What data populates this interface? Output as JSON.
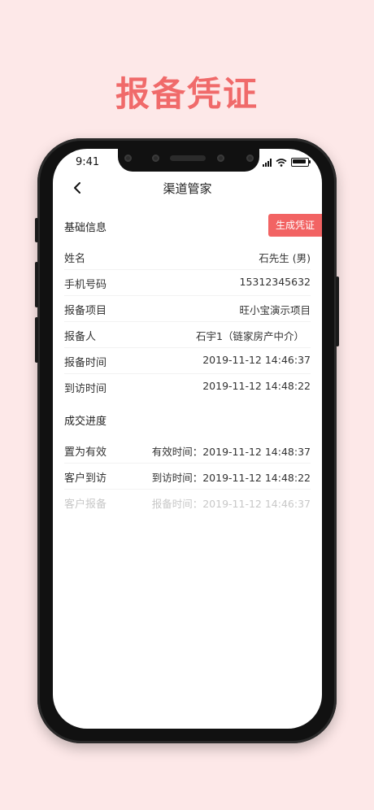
{
  "headline": "报备凭证",
  "status_bar": {
    "time": "9:41"
  },
  "nav": {
    "title": "渠道管家"
  },
  "basic": {
    "title": "基础信息",
    "generate_button": "生成凭证",
    "rows": [
      {
        "label": "姓名",
        "value": "石先生 (男)"
      },
      {
        "label": "手机号码",
        "value": "15312345632"
      },
      {
        "label": "报备项目",
        "value": "旺小宝演示项目"
      },
      {
        "label": "报备人",
        "value": "石宇1（链家房产中介）"
      },
      {
        "label": "报备时间",
        "value": "2019-11-12 14:46:37"
      },
      {
        "label": "到访时间",
        "value": "2019-11-12 14:48:22"
      }
    ]
  },
  "progress": {
    "title": "成交进度",
    "rows": [
      {
        "label": "置为有效",
        "value": "有效时间：2019-11-12 14:48:37"
      },
      {
        "label": "客户到访",
        "value": "到访时间：2019-11-12 14:48:22"
      },
      {
        "label": "客户报备",
        "value": "报备时间：2019-11-12 14:46:37"
      }
    ]
  }
}
